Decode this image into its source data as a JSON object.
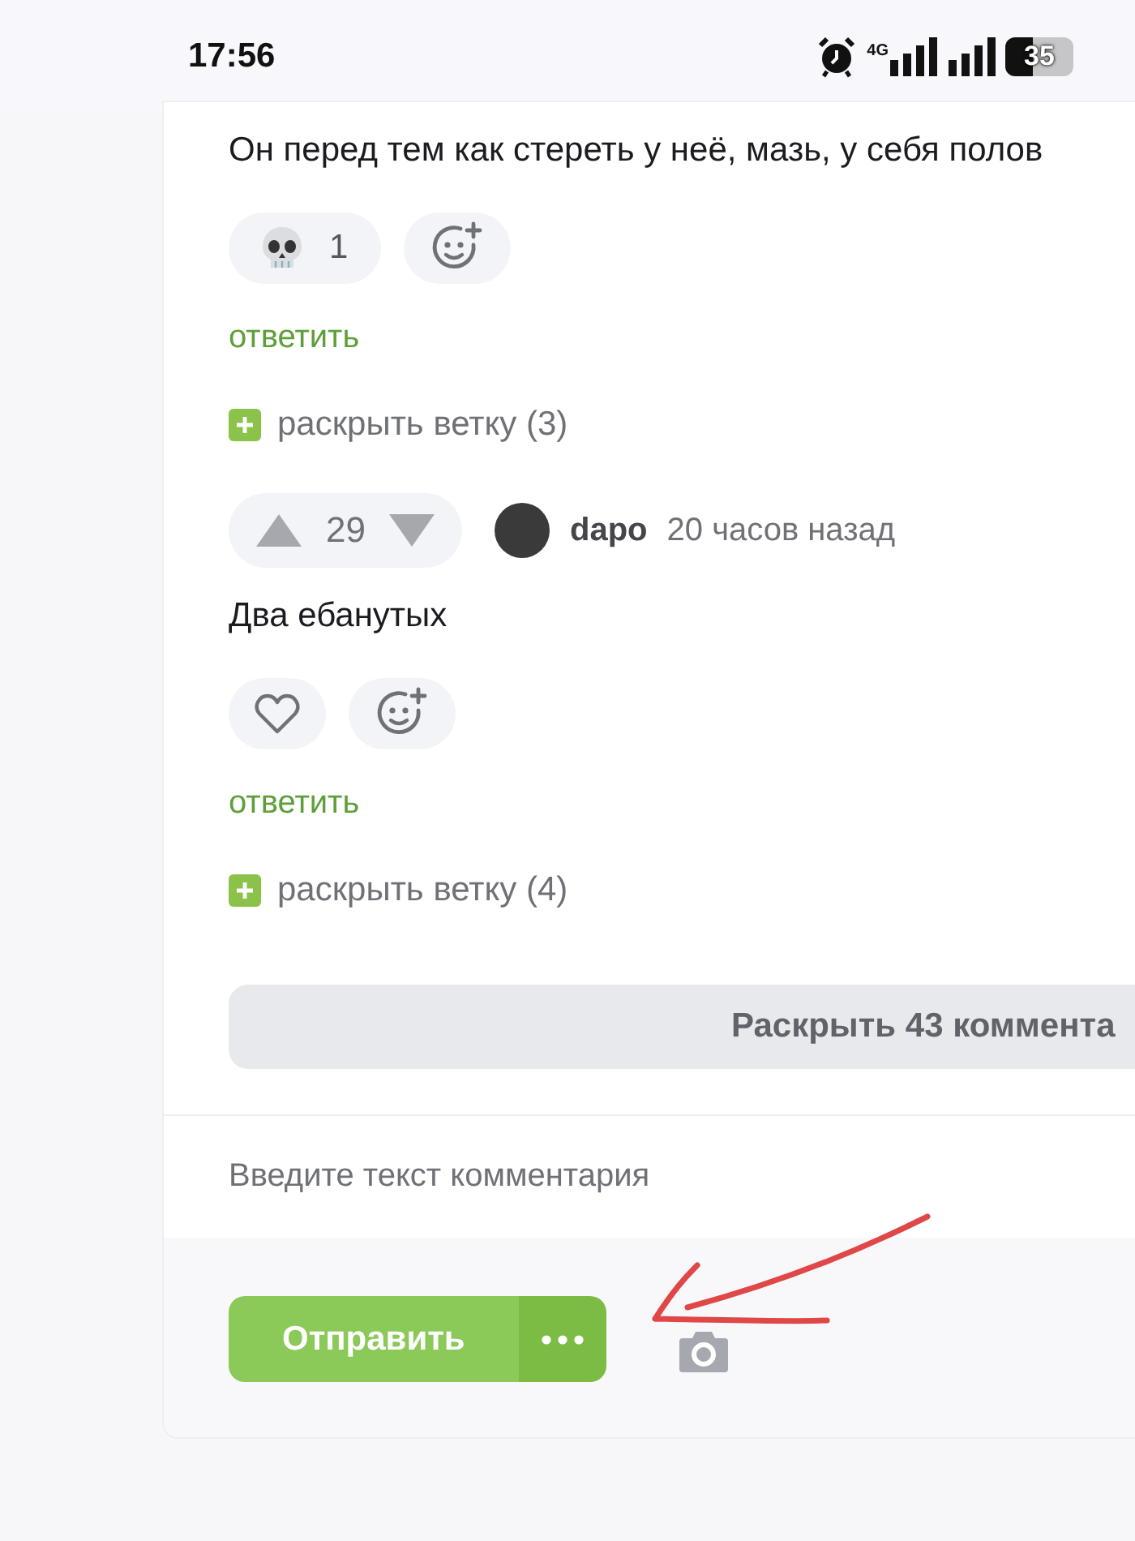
{
  "status_bar": {
    "time": "17:56",
    "network": "4G",
    "battery": "35"
  },
  "comments": [
    {
      "kind": "tail",
      "text": "Он перед тем как стереть у неё, мазь, у себя полов",
      "reactions": [
        {
          "kind": "skull",
          "count": "1"
        },
        {
          "kind": "add"
        }
      ],
      "reply_link": "ответить",
      "expand_thread": "раскрыть ветку (3)"
    },
    {
      "kind": "full",
      "votes": "29",
      "author": "dapo",
      "time": "20 часов назад",
      "text": "Два ебанутых",
      "reactions": [
        {
          "kind": "like"
        },
        {
          "kind": "add"
        }
      ],
      "reply_link": "ответить",
      "expand_thread": "раскрыть ветку (4)"
    }
  ],
  "expand_all": "Раскрыть 43 коммента",
  "composer": {
    "placeholder": "Введите текст комментария",
    "send_label": "Отправить"
  }
}
